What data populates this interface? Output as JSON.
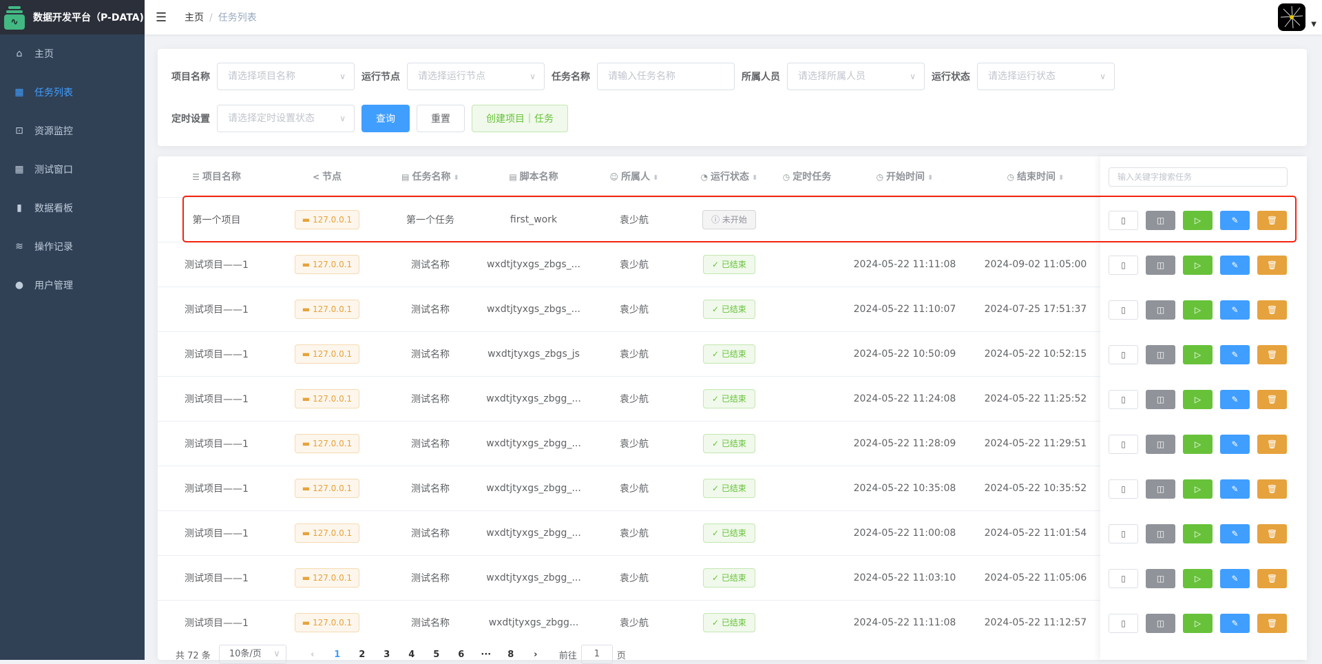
{
  "app": {
    "title": "数据开发平台（P-DATA)"
  },
  "sidebar": {
    "items": [
      {
        "label": "主页",
        "icon": "home-icon"
      },
      {
        "label": "任务列表",
        "icon": "grid-icon",
        "active": true
      },
      {
        "label": "资源监控",
        "icon": "monitor-icon"
      },
      {
        "label": "测试窗口",
        "icon": "grid-icon"
      },
      {
        "label": "数据看板",
        "icon": "bar-chart-icon"
      },
      {
        "label": "操作记录",
        "icon": "database-icon"
      },
      {
        "label": "用户管理",
        "icon": "user-icon"
      }
    ]
  },
  "breadcrumb": {
    "home": "主页",
    "sep": "/",
    "current": "任务列表"
  },
  "filters": {
    "project": {
      "label": "项目名称",
      "placeholder": "请选择项目名称"
    },
    "node": {
      "label": "运行节点",
      "placeholder": "请选择运行节点"
    },
    "task": {
      "label": "任务名称",
      "placeholder": "请输入任务名称"
    },
    "owner": {
      "label": "所属人员",
      "placeholder": "请选择所属人员"
    },
    "status": {
      "label": "运行状态",
      "placeholder": "请选择运行状态"
    },
    "timer": {
      "label": "定时设置",
      "placeholder": "请选择定时设置状态"
    },
    "query": "查询",
    "reset": "重置",
    "create": "创建项目｜任务"
  },
  "table": {
    "headers": [
      "项目名称",
      "节点",
      "任务名称",
      "脚本名称",
      "所属人",
      "运行状态",
      "定时任务",
      "开始时间",
      "结束时间"
    ],
    "search_placeholder": "输入关键字搜索任务",
    "rows": [
      {
        "project": "第一个项目",
        "node": "127.0.0.1",
        "task": "第一个任务",
        "script": "first_work",
        "owner": "袁少航",
        "status": "未开始",
        "start": "",
        "end": ""
      },
      {
        "project": "测试项目——1",
        "node": "127.0.0.1",
        "task": "测试名称",
        "script": "wxdtjtyxgs_zbgs_...",
        "owner": "袁少航",
        "status": "已结束",
        "start": "2024-05-22 11:11:08",
        "end": "2024-09-02 11:05:00"
      },
      {
        "project": "测试项目——1",
        "node": "127.0.0.1",
        "task": "测试名称",
        "script": "wxdtjtyxgs_zbgs_...",
        "owner": "袁少航",
        "status": "已结束",
        "start": "2024-05-22 11:10:07",
        "end": "2024-07-25 17:51:37"
      },
      {
        "project": "测试项目——1",
        "node": "127.0.0.1",
        "task": "测试名称",
        "script": "wxdtjtyxgs_zbgs_js",
        "owner": "袁少航",
        "status": "已结束",
        "start": "2024-05-22 10:50:09",
        "end": "2024-05-22 10:52:15"
      },
      {
        "project": "测试项目——1",
        "node": "127.0.0.1",
        "task": "测试名称",
        "script": "wxdtjtyxgs_zbgg_...",
        "owner": "袁少航",
        "status": "已结束",
        "start": "2024-05-22 11:24:08",
        "end": "2024-05-22 11:25:52"
      },
      {
        "project": "测试项目——1",
        "node": "127.0.0.1",
        "task": "测试名称",
        "script": "wxdtjtyxgs_zbgg_...",
        "owner": "袁少航",
        "status": "已结束",
        "start": "2024-05-22 11:28:09",
        "end": "2024-05-22 11:29:51"
      },
      {
        "project": "测试项目——1",
        "node": "127.0.0.1",
        "task": "测试名称",
        "script": "wxdtjtyxgs_zbgg_...",
        "owner": "袁少航",
        "status": "已结束",
        "start": "2024-05-22 10:35:08",
        "end": "2024-05-22 10:35:52"
      },
      {
        "project": "测试项目——1",
        "node": "127.0.0.1",
        "task": "测试名称",
        "script": "wxdtjtyxgs_zbgg_...",
        "owner": "袁少航",
        "status": "已结束",
        "start": "2024-05-22 11:00:08",
        "end": "2024-05-22 11:01:54"
      },
      {
        "project": "测试项目——1",
        "node": "127.0.0.1",
        "task": "测试名称",
        "script": "wxdtjtyxgs_zbgg_...",
        "owner": "袁少航",
        "status": "已结束",
        "start": "2024-05-22 11:03:10",
        "end": "2024-05-22 11:05:06"
      },
      {
        "project": "测试项目——1",
        "node": "127.0.0.1",
        "task": "测试名称",
        "script": "wxdtjtyxgs_zbgg...",
        "owner": "袁少航",
        "status": "已结束",
        "start": "2024-05-22 11:11:08",
        "end": "2024-05-22 11:12:57"
      }
    ]
  },
  "pagination": {
    "total": "共 72 条",
    "page_size": "10条/页",
    "pages": [
      "1",
      "2",
      "3",
      "4",
      "5",
      "6",
      "···",
      "8"
    ],
    "current": "1",
    "goto_label": "前往",
    "goto_value": "1",
    "page_suffix": "页"
  },
  "colors": {
    "primary": "#409eff",
    "success": "#67c23a",
    "warning": "#e6a23c",
    "info": "#909399",
    "sidebar": "#304156",
    "highlight": "#f5220d"
  }
}
